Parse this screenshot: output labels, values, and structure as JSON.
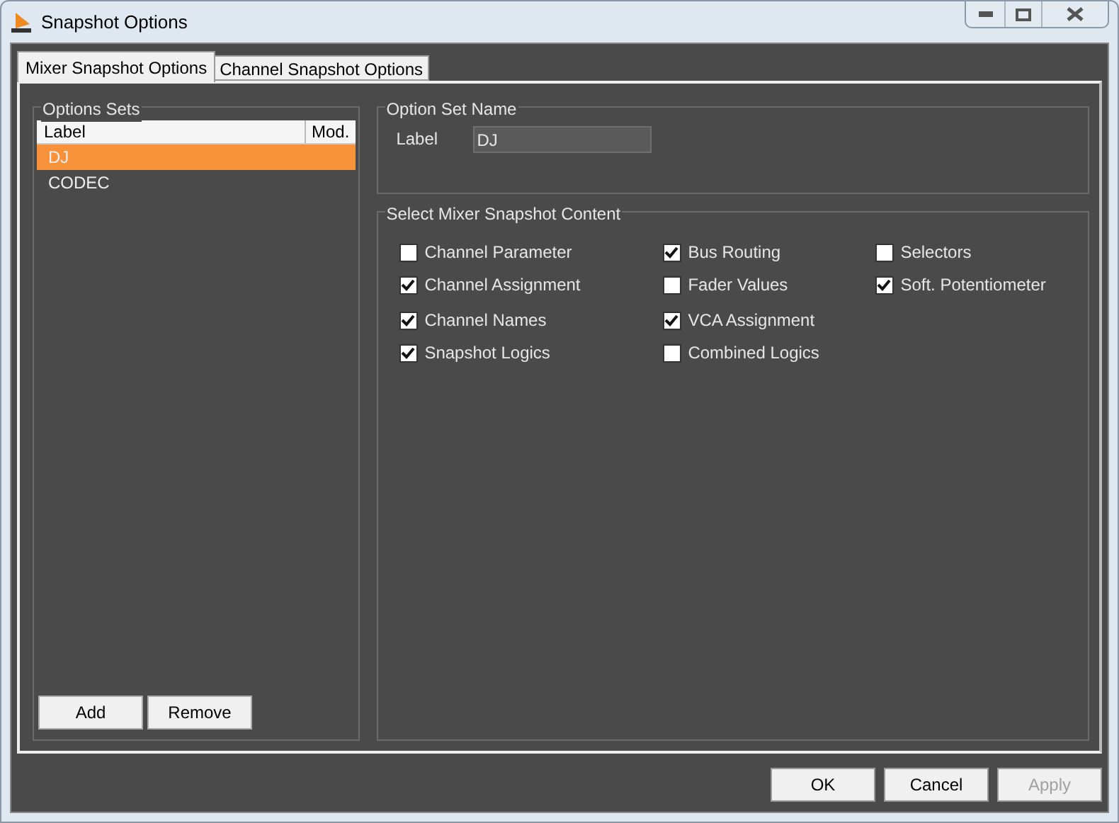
{
  "window": {
    "title": "Snapshot Options"
  },
  "tabs": [
    {
      "label": "Mixer Snapshot Options",
      "selected": true
    },
    {
      "label": "Channel Snapshot Options",
      "selected": false
    }
  ],
  "options_sets": {
    "title": "Options Sets",
    "columns": [
      "Label",
      "Mod."
    ],
    "rows": [
      {
        "label": "DJ",
        "selected": true
      },
      {
        "label": "CODEC",
        "selected": false
      }
    ],
    "buttons": [
      "Add",
      "Remove"
    ]
  },
  "option_set_name": {
    "title": "Option Set Name",
    "field_label": "Label",
    "value": "DJ"
  },
  "content": {
    "title": "Select Mixer Snapshot Content",
    "columns": [
      [
        {
          "label": "Channel Parameter",
          "checked": false
        },
        {
          "label": "Channel Assignment",
          "checked": true
        },
        {
          "label": "Channel Names",
          "checked": true
        },
        {
          "label": "Snapshot Logics",
          "checked": true
        }
      ],
      [
        {
          "label": "Bus Routing",
          "checked": true
        },
        {
          "label": "Fader Values",
          "checked": false
        },
        {
          "label": "VCA Assignment",
          "checked": true
        },
        {
          "label": "Combined Logics",
          "checked": false
        }
      ],
      [
        {
          "label": "Selectors",
          "checked": false
        },
        {
          "label": "Soft. Potentiometer",
          "checked": true
        }
      ]
    ]
  },
  "buttons": [
    {
      "label": "OK",
      "disabled": false
    },
    {
      "label": "Cancel",
      "disabled": false
    },
    {
      "label": "Apply",
      "disabled": true
    }
  ]
}
